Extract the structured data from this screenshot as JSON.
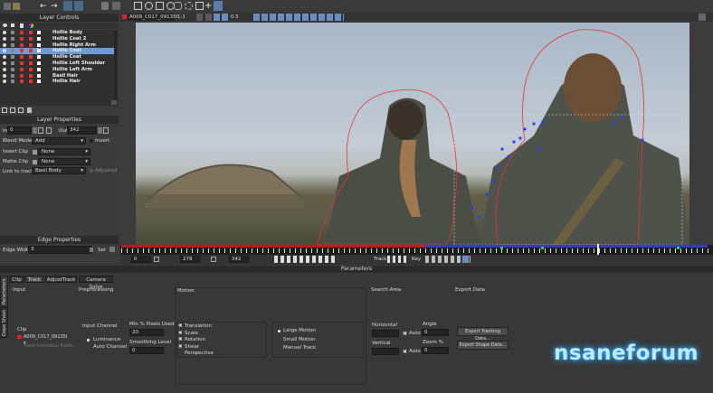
{
  "colors": {
    "accent": "#6e9bd1",
    "mask_red": "#e23434",
    "track_blue": "#2f3dbf",
    "timeline_red": "#c11818",
    "keyframe_green": "#2fcf3f"
  },
  "layer_controls": {
    "title": "Layer Controls",
    "layers": [
      {
        "name": "Hollie Body",
        "selected": false
      },
      {
        "name": "Hollie Coat 2",
        "selected": false
      },
      {
        "name": "Hollie Right Arm",
        "selected": false
      },
      {
        "name": "Hollie Coat",
        "selected": true
      },
      {
        "name": "Hollie Coat",
        "selected": false
      },
      {
        "name": "Hollie Left Shoulder",
        "selected": false
      },
      {
        "name": "Hollie Left Arm",
        "selected": false
      },
      {
        "name": "Basil Hair",
        "selected": false
      },
      {
        "name": "Hollie Hair",
        "selected": false
      }
    ]
  },
  "layer_properties": {
    "title": "Layer Properties",
    "in_label": "In",
    "in_value": "0",
    "out_label": "Out",
    "out_value": "342",
    "blend_mode_label": "Blend Mode",
    "blend_mode_value": "Add",
    "invert_label": "Invert",
    "insert_clip_label": "Insert Clip",
    "insert_clip_value": "None",
    "matte_clip_label": "Matte Clip",
    "matte_clip_value": "None",
    "link_track_label": "Link to track",
    "link_track_value": "Basil Body",
    "adjusted_label": "Adjusted"
  },
  "edge_properties": {
    "title": "Edge Properties",
    "edge_width_label": "Edge Width",
    "edge_width_value": "3",
    "set_label": "Set"
  },
  "viewer_toolbar": {
    "clip_name": "A009_C017_09135I",
    "zoom": "1:1",
    "opacity": "0.5"
  },
  "timeline": {
    "frame_start": "0",
    "frame_current": "278",
    "frame_end": "342",
    "track_label": "Track",
    "key_label": "Key",
    "red_end_fraction": 0.52,
    "playhead_fraction": 0.81
  },
  "parameters": {
    "title": "Parameters",
    "side_tabs": [
      "Parameters",
      "Dope Sheet"
    ],
    "tabs": [
      "Clip",
      "Track",
      "AdjustTrack",
      "Camera Solve"
    ],
    "active_tab": "Track",
    "input": {
      "title": "Input",
      "clip_label": "Clip",
      "clip_value": "A009_C017_09135I",
      "track_individual_fields": "Track Individual Fields"
    },
    "preprocessing": {
      "title": "Preprocessing",
      "input_channel_label": "Input Channel",
      "luminance": "Luminance",
      "auto_channel": "Auto Channel",
      "min_pixels_label": "Min % Pixels Used",
      "min_pixels_value": "20",
      "smoothing_label": "Smoothing Level",
      "smoothing_value": "0"
    },
    "motion": {
      "title": "Motion",
      "options": [
        "Translation",
        "Scale",
        "Rotation",
        "Shear",
        "Perspective"
      ],
      "checked": [
        true,
        true,
        true,
        true,
        false
      ],
      "modes": [
        "Large Motion",
        "Small Motion",
        "Manual Track"
      ]
    },
    "search_area": {
      "title": "Search Area",
      "horizontal_label": "Horizontal",
      "vertical_label": "Vertical",
      "auto_label": "Auto",
      "angle_label": "Angle",
      "angle_value": "0",
      "zoom_label": "Zoom %",
      "zoom_value": "0"
    },
    "export_data": {
      "title": "Export Data",
      "export_tracking": "Export Tracking Data...",
      "export_shape": "Export Shape Data..."
    }
  },
  "watermark": "nsaneforum"
}
